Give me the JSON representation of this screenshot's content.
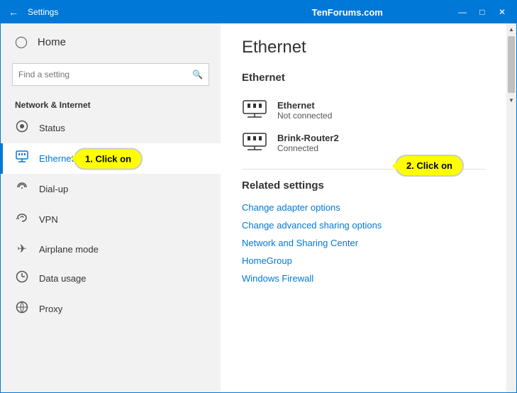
{
  "window": {
    "title": "Settings",
    "watermark": "TenForums.com"
  },
  "titlebar": {
    "back_icon": "←",
    "minimize": "—",
    "maximize": "□",
    "close": "✕"
  },
  "sidebar": {
    "home_label": "Home",
    "search_placeholder": "Find a setting",
    "section_label": "Network & Internet",
    "nav_items": [
      {
        "id": "status",
        "label": "Status",
        "icon": "⊕"
      },
      {
        "id": "ethernet",
        "label": "Ethernet",
        "icon": "🖥",
        "active": true
      },
      {
        "id": "dialup",
        "label": "Dial-up",
        "icon": "☎"
      },
      {
        "id": "vpn",
        "label": "VPN",
        "icon": "⟲"
      },
      {
        "id": "airplane",
        "label": "Airplane mode",
        "icon": "✈"
      },
      {
        "id": "datausage",
        "label": "Data usage",
        "icon": "⏱"
      },
      {
        "id": "proxy",
        "label": "Proxy",
        "icon": "⊗"
      }
    ]
  },
  "main": {
    "page_title": "Ethernet",
    "networks_title": "Ethernet",
    "networks": [
      {
        "id": "eth1",
        "name": "Ethernet",
        "status": "Not connected"
      },
      {
        "id": "eth2",
        "name": "Brink-Router2",
        "status": "Connected"
      }
    ],
    "related_title": "Related settings",
    "related_links": [
      {
        "id": "adapter",
        "label": "Change adapter options"
      },
      {
        "id": "sharing",
        "label": "Change advanced sharing options"
      },
      {
        "id": "center",
        "label": "Network and Sharing Center"
      },
      {
        "id": "homegroup",
        "label": "HomeGroup"
      },
      {
        "id": "firewall",
        "label": "Windows Firewall"
      }
    ]
  },
  "callouts": {
    "callout1": "1. Click on",
    "callout2": "2. Click on"
  }
}
